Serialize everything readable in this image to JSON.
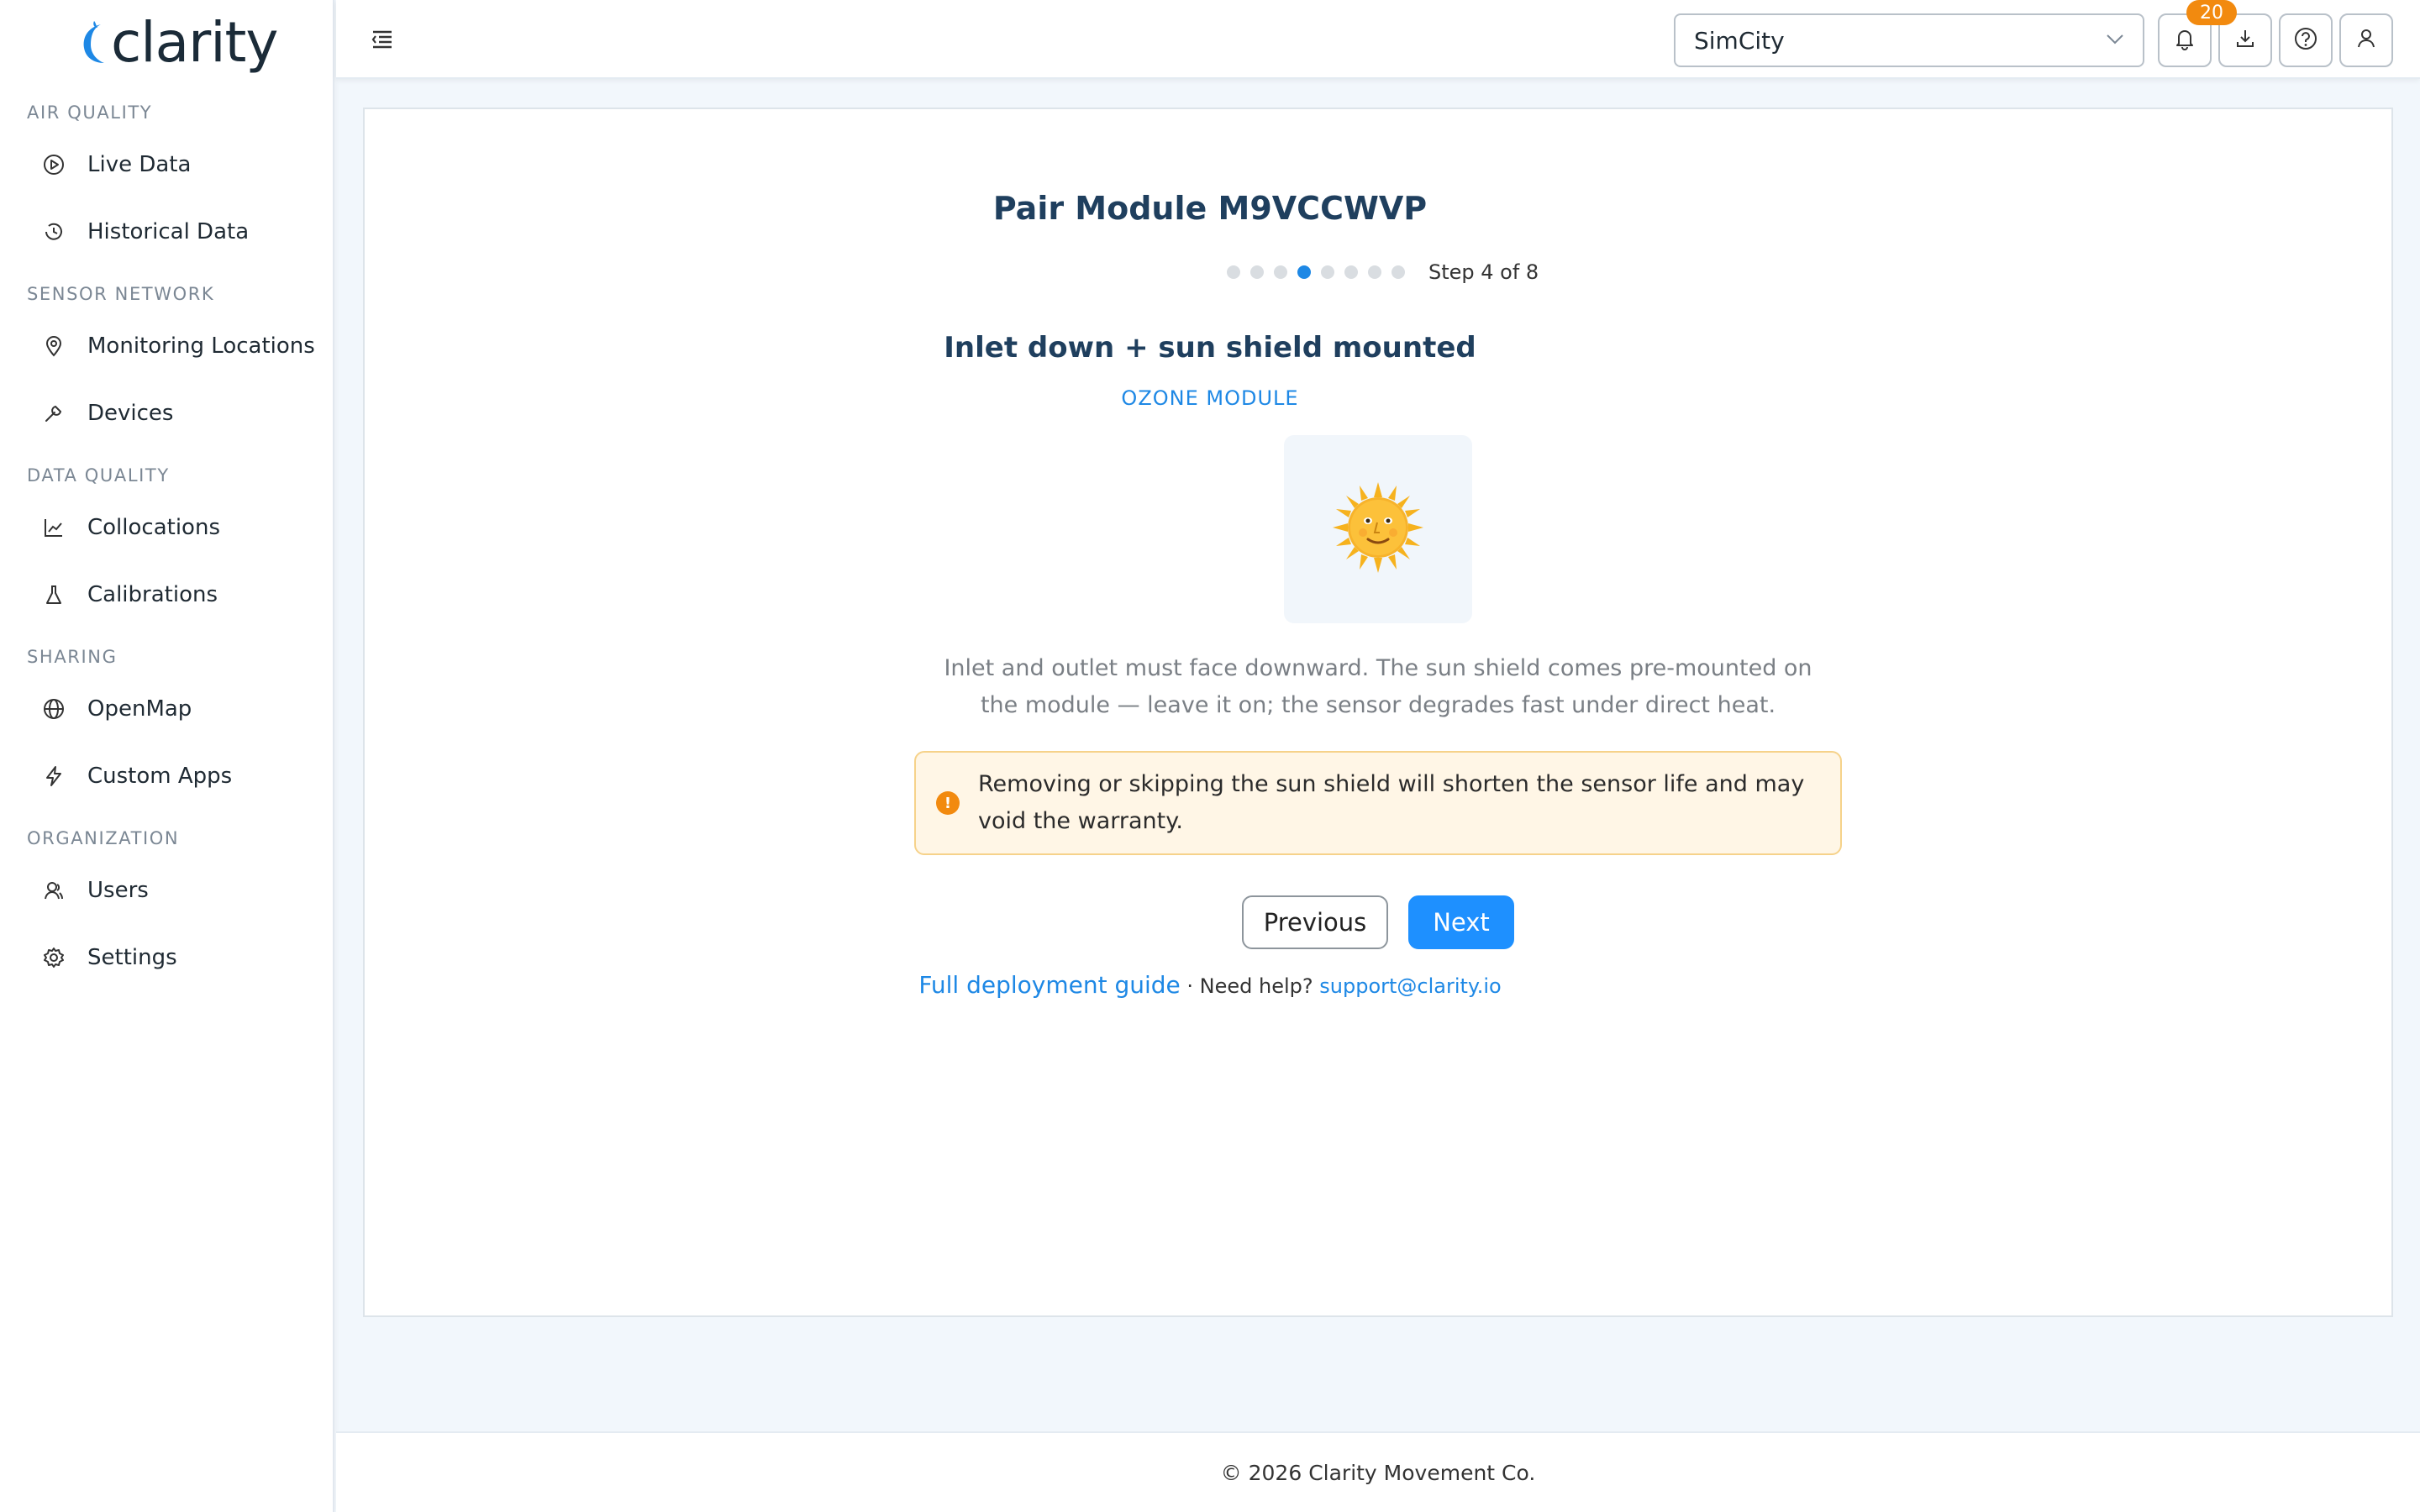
{
  "brand": {
    "name": "clarity",
    "accent": "#1e88e5"
  },
  "sidebar": {
    "sections": [
      {
        "label": "AIR QUALITY",
        "items": [
          {
            "label": "Live Data",
            "icon": "play-circle-icon"
          },
          {
            "label": "Historical Data",
            "icon": "history-icon"
          }
        ]
      },
      {
        "label": "SENSOR NETWORK",
        "items": [
          {
            "label": "Monitoring Locations",
            "icon": "location-pin-icon"
          },
          {
            "label": "Devices",
            "icon": "wrench-icon"
          }
        ]
      },
      {
        "label": "DATA QUALITY",
        "items": [
          {
            "label": "Collocations",
            "icon": "line-chart-icon"
          },
          {
            "label": "Calibrations",
            "icon": "flask-icon"
          }
        ]
      },
      {
        "label": "SHARING",
        "items": [
          {
            "label": "OpenMap",
            "icon": "globe-icon"
          },
          {
            "label": "Custom Apps",
            "icon": "bolt-icon"
          }
        ]
      },
      {
        "label": "ORGANIZATION",
        "items": [
          {
            "label": "Users",
            "icon": "users-icon"
          },
          {
            "label": "Settings",
            "icon": "gear-icon"
          }
        ]
      }
    ]
  },
  "topbar": {
    "org_select": {
      "value": "SimCity"
    },
    "notifications_count": "20"
  },
  "wizard": {
    "title": "Pair Module M9VCCWVP",
    "step_total": 8,
    "step_current": 4,
    "step_text": "Step 4 of 8",
    "step_heading": "Inlet down + sun shield mounted",
    "module_tag": "OZONE MODULE",
    "hero_emoji": "🌞",
    "description": "Inlet and outlet must face downward. The sun shield comes pre-mounted on the module — leave it on; the sensor degrades fast under direct heat.",
    "warning": "Removing or skipping the sun shield will shorten the sensor life and may void the warranty.",
    "prev_label": "Previous",
    "next_label": "Next",
    "guide_link": "Full deployment guide",
    "help_text": " · Need help? ",
    "support_email": "support@clarity.io"
  },
  "footer": {
    "copyright": "© 2026 Clarity Movement Co."
  }
}
